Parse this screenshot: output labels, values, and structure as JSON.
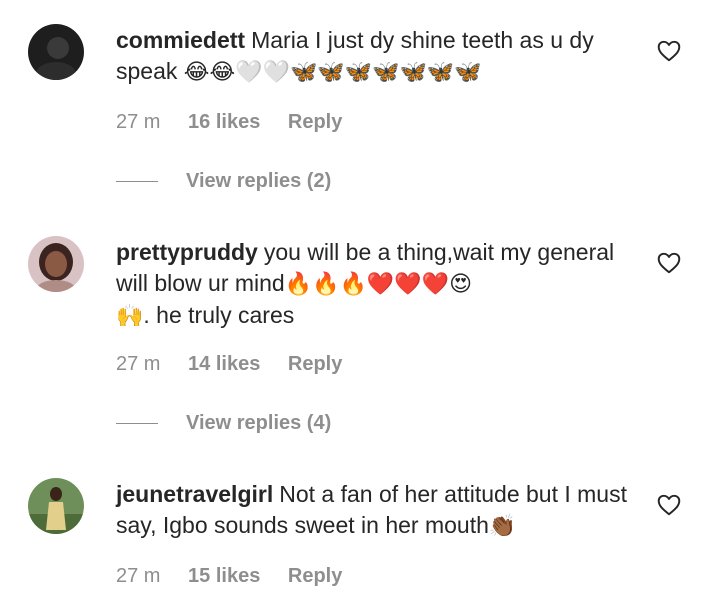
{
  "comments": [
    {
      "username": "commiedett",
      "text": "Maria I just dy shine teeth as u dy speak",
      "emojis": "😂😂🤍🤍🦋🦋🦋🦋🦋🦋🦋",
      "time": "27 m",
      "likes": "16 likes",
      "reply_label": "Reply",
      "view_replies": "View replies (2)",
      "avatar_icon": "dark-avatar"
    },
    {
      "username": "prettypruddy",
      "text": "you will be a thing,wait my general will blow ur mind",
      "emojis": "🔥🔥🔥❤️❤️❤️😍",
      "text2_emoji": "🙌",
      "text2": ". he truly cares",
      "time": "27 m",
      "likes": "14 likes",
      "reply_label": "Reply",
      "view_replies": "View replies (4)",
      "avatar_icon": "woman-portrait"
    },
    {
      "username": "jeunetravelgirl",
      "text": "Not a fan of her attitude but I must say, Igbo sounds sweet in her mouth",
      "emojis": "👏🏾",
      "time": "27 m",
      "likes": "15 likes",
      "reply_label": "Reply",
      "avatar_icon": "outdoor-portrait"
    }
  ],
  "colors": {
    "text": "#262626",
    "secondary": "#8e8e8e",
    "background": "#ffffff"
  }
}
